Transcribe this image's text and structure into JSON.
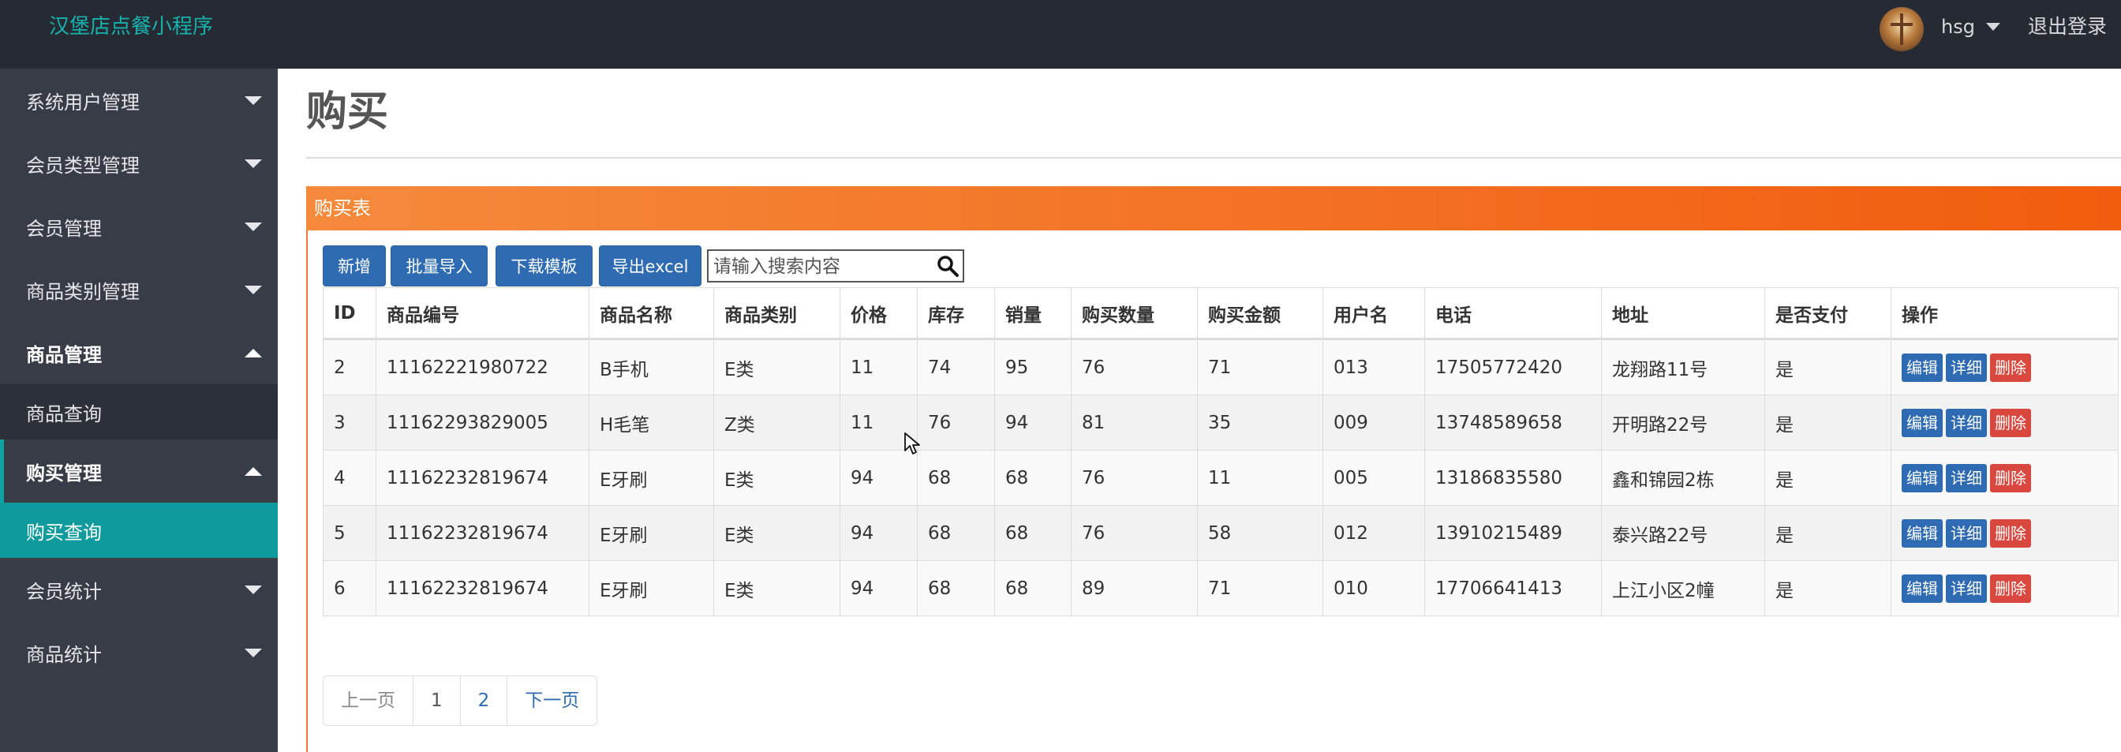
{
  "app": {
    "title": "汉堡店点餐小程序",
    "user": "hsg",
    "logout_label": "退出登录"
  },
  "sidebar": {
    "items": [
      {
        "label": "系统用户管理"
      },
      {
        "label": "会员类型管理"
      },
      {
        "label": "会员管理"
      },
      {
        "label": "商品类别管理"
      },
      {
        "label": "商品管理"
      },
      {
        "label": "商品查询"
      },
      {
        "label": "购买管理"
      },
      {
        "label": "购买查询"
      },
      {
        "label": "会员统计"
      },
      {
        "label": "商品统计"
      }
    ]
  },
  "main": {
    "page_title": "购买",
    "panel_title": "购买表",
    "buttons": {
      "add": "新增",
      "batch_import": "批量导入",
      "download_template": "下载模板",
      "export_excel": "导出excel"
    },
    "search": {
      "placeholder": "请输入搜索内容",
      "value": ""
    },
    "table": {
      "headers": [
        "ID",
        "商品编号",
        "商品名称",
        "商品类别",
        "价格",
        "库存",
        "销量",
        "购买数量",
        "购买金额",
        "用户名",
        "电话",
        "地址",
        "是否支付",
        "操作"
      ],
      "rows": [
        {
          "id": "2",
          "product_no": "11162221980722",
          "name": "B手机",
          "category": "E类",
          "price": "11",
          "stock": "74",
          "sales": "95",
          "qty": "76",
          "amount": "71",
          "username": "013",
          "phone": "17505772420",
          "address": "龙翔路11号",
          "paid": "是"
        },
        {
          "id": "3",
          "product_no": "11162293829005",
          "name": "H毛笔",
          "category": "Z类",
          "price": "11",
          "stock": "76",
          "sales": "94",
          "qty": "81",
          "amount": "35",
          "username": "009",
          "phone": "13748589658",
          "address": "开明路22号",
          "paid": "是"
        },
        {
          "id": "4",
          "product_no": "11162232819674",
          "name": "E牙刷",
          "category": "E类",
          "price": "94",
          "stock": "68",
          "sales": "68",
          "qty": "76",
          "amount": "11",
          "username": "005",
          "phone": "13186835580",
          "address": "鑫和锦园2栋",
          "paid": "是"
        },
        {
          "id": "5",
          "product_no": "11162232819674",
          "name": "E牙刷",
          "category": "E类",
          "price": "94",
          "stock": "68",
          "sales": "68",
          "qty": "76",
          "amount": "58",
          "username": "012",
          "phone": "13910215489",
          "address": "泰兴路22号",
          "paid": "是"
        },
        {
          "id": "6",
          "product_no": "11162232819674",
          "name": "E牙刷",
          "category": "E类",
          "price": "94",
          "stock": "68",
          "sales": "68",
          "qty": "89",
          "amount": "71",
          "username": "010",
          "phone": "17706641413",
          "address": "上江小区2幢",
          "paid": "是"
        }
      ],
      "actions": {
        "edit": "编辑",
        "detail": "详细",
        "delete": "删除"
      }
    },
    "pagination": {
      "prev": "上一页",
      "pages": [
        "1",
        "2"
      ],
      "next": "下一页"
    }
  },
  "colors": {
    "topbar": "#252a33",
    "sidebar": "#373c47",
    "brand": "#17b2ad",
    "active_nav": "#0f9b9e",
    "panel_header": "#f25c0f",
    "primary_button": "#2e6bb2",
    "danger_button": "#d9473f"
  },
  "icons": [
    "chevron-down-icon",
    "chevron-up-icon",
    "search-icon",
    "avatar",
    "mouse-cursor-icon"
  ]
}
